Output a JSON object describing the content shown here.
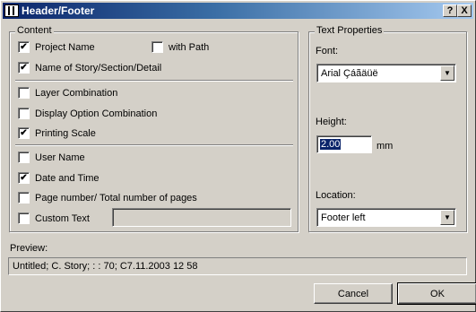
{
  "window": {
    "title": "Header/Footer",
    "help_btn": "?",
    "close_btn": "X"
  },
  "content": {
    "title": "Content",
    "project_name": {
      "label": "Project Name",
      "checked": true
    },
    "with_path": {
      "label": "with Path",
      "checked": false
    },
    "story_section": {
      "label": "Name of Story/Section/Detail",
      "checked": true
    },
    "layer_combination": {
      "label": "Layer Combination",
      "checked": false
    },
    "display_option": {
      "label": "Display Option Combination",
      "checked": false
    },
    "printing_scale": {
      "label": "Printing Scale",
      "checked": true
    },
    "user_name": {
      "label": "User Name",
      "checked": false
    },
    "date_time": {
      "label": "Date and Time",
      "checked": true
    },
    "page_number": {
      "label": "Page number/ Total number of pages",
      "checked": false
    },
    "custom_text": {
      "label": "Custom Text",
      "checked": false,
      "value": ""
    }
  },
  "text_properties": {
    "title": "Text Properties",
    "font_label": "Font:",
    "font_value": "Arial Çáãäüë",
    "height_label": "Height:",
    "height_value": "2.00",
    "height_unit": "mm",
    "location_label": "Location:",
    "location_value": "Footer left"
  },
  "preview": {
    "label": "Preview:",
    "text": "Untitled; C. Story; : : 70; C7.11.2003 12 58"
  },
  "buttons": {
    "cancel": "Cancel",
    "ok": "OK"
  }
}
